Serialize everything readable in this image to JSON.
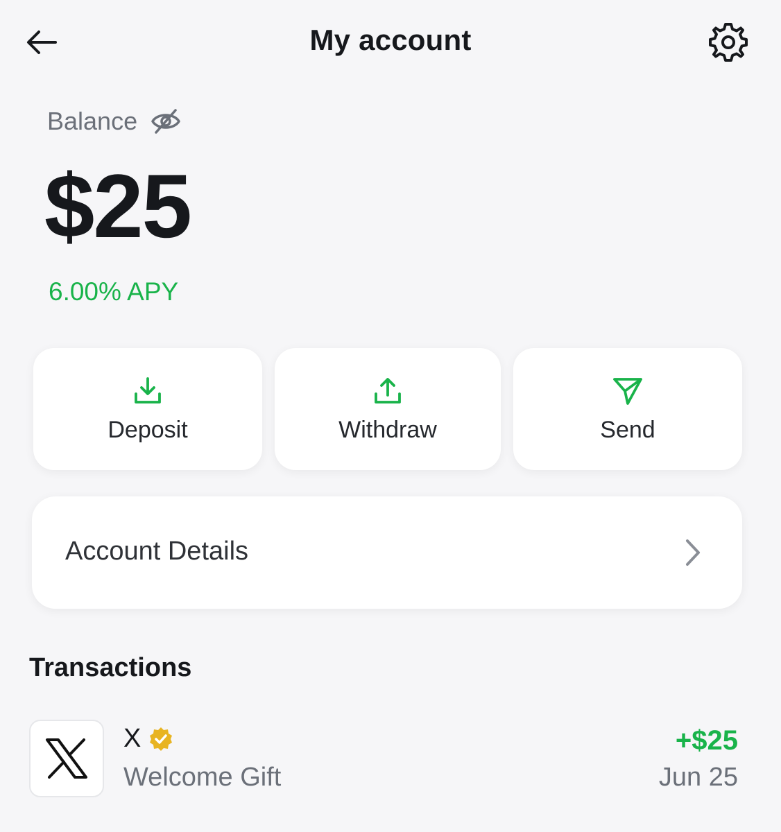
{
  "header": {
    "title": "My account"
  },
  "balance": {
    "label": "Balance",
    "amount": "$25",
    "apy": "6.00% APY"
  },
  "actions": [
    {
      "label": "Deposit",
      "icon": "deposit-icon"
    },
    {
      "label": "Withdraw",
      "icon": "withdraw-icon"
    },
    {
      "label": "Send",
      "icon": "send-icon"
    }
  ],
  "account_details": {
    "label": "Account Details"
  },
  "transactions": {
    "title": "Transactions",
    "items": [
      {
        "name": "X",
        "description": "Welcome Gift",
        "amount": "+$25",
        "date": "Jun 25",
        "verified": true,
        "logo": "x-logo-icon"
      }
    ]
  },
  "colors": {
    "accent_green": "#19b34a",
    "verified_gold": "#e8b422",
    "background": "#f6f6f8"
  }
}
